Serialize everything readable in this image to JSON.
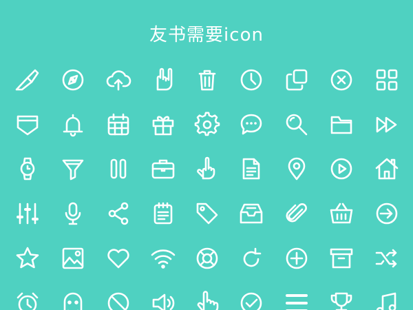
{
  "title": "友书需要icon",
  "colors": {
    "background": "#4fd1c1",
    "icon": "#ffffff"
  },
  "icons": [
    [
      "knife-icon",
      "compass-icon",
      "cloud-upload-icon",
      "rock-hand-icon",
      "trash-icon",
      "clock-icon",
      "copy-icon",
      "close-circle-icon",
      "grid-icon"
    ],
    [
      "pocket-icon",
      "bell-icon",
      "calendar-icon",
      "gift-icon",
      "gear-icon",
      "chat-bubble-icon",
      "search-icon",
      "folder-icon",
      "fast-forward-icon"
    ],
    [
      "watch-icon",
      "funnel-icon",
      "pause-icon",
      "briefcase-icon",
      "middle-finger-icon",
      "document-icon",
      "location-pin-icon",
      "play-circle-icon",
      "home-icon"
    ],
    [
      "sliders-icon",
      "microphone-icon",
      "share-icon",
      "notepad-icon",
      "tag-icon",
      "inbox-icon",
      "paperclip-icon",
      "basket-icon",
      "sign-in-icon"
    ],
    [
      "star-icon",
      "image-icon",
      "heart-icon",
      "wifi-icon",
      "lifebuoy-icon",
      "refresh-icon",
      "add-circle-icon",
      "archive-box-icon",
      "shuffle-icon"
    ],
    [
      "alarm-clock-icon",
      "ghost-icon",
      "no-entry-icon",
      "speaker-icon",
      "pointing-hand-icon",
      "check-circle-icon",
      "menu-icon",
      "trophy-icon",
      "music-note-icon"
    ]
  ]
}
